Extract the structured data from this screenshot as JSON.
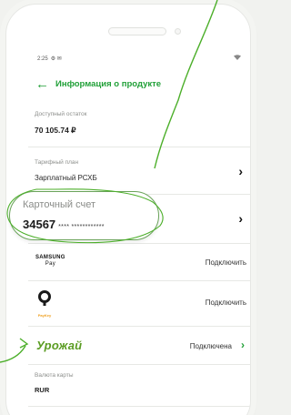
{
  "status": {
    "time": "2:25",
    "icons": "⚙ ✉",
    "right_icon": "wifi-icon"
  },
  "header": {
    "back_icon": "arrow-left-icon",
    "title": "Информация о продукте"
  },
  "balance": {
    "label": "Доступный остаток",
    "value": "70 105.74 ₽"
  },
  "tariff": {
    "label": "Тарифный план",
    "value": "Зарплатный РСХБ"
  },
  "card_account": {
    "label": "Карточный счет",
    "value": "34567",
    "mask": "**** ************"
  },
  "samsung_pay": {
    "logo_top": "SAMSUNG",
    "logo_bottom": "Pay",
    "action": "Подключить"
  },
  "paykey": {
    "logo_text": "PayKey",
    "action": "Подключить"
  },
  "harvest": {
    "logo_text": "Урожай",
    "action": "Подключена"
  },
  "currency": {
    "label": "Валюта карты",
    "value": "RUR"
  },
  "colors": {
    "accent": "#21a038",
    "annotation": "#4caf2a"
  }
}
